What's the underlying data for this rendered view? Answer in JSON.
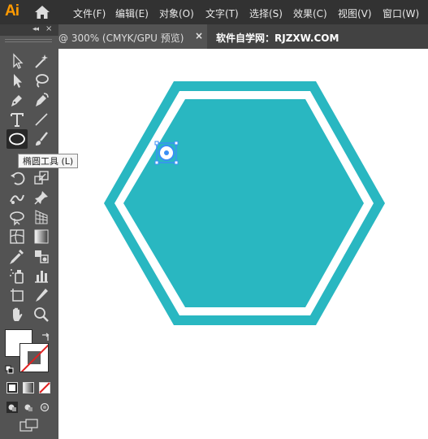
{
  "app": {
    "logo": "Ai"
  },
  "menu": {
    "items": [
      "文件(F)",
      "编辑(E)",
      "对象(O)",
      "文字(T)",
      "选择(S)",
      "效果(C)",
      "视图(V)",
      "窗口(W)"
    ]
  },
  "tabs": {
    "document": "@ 300% (CMYK/GPU 预览)",
    "close": "×",
    "site": "软件自学网：RJZXW.COM"
  },
  "toolpanel": {
    "collapse": "◂◂",
    "close": "×"
  },
  "tooltip": {
    "text": "椭圆工具 (L)"
  },
  "colors": {
    "accent_teal": "#29b7c1",
    "toolbar_bg": "#535353",
    "menubar_bg": "#323232"
  },
  "icons": [
    "selection-icon",
    "magic-wand-icon",
    "direct-selection-icon",
    "lasso-icon",
    "pen-icon",
    "curvature-icon",
    "type-icon",
    "line-segment-icon",
    "ellipse-icon",
    "paintbrush-icon",
    "rotate-icon",
    "scale-icon",
    "puppet-warp-icon",
    "pin-icon",
    "free-transform-icon",
    "perspective-grid-icon",
    "mesh-icon",
    "gradient-icon",
    "eyedropper-icon",
    "blend-icon",
    "symbol-sprayer-icon",
    "column-graph-icon",
    "artboard-icon",
    "slice-icon",
    "hand-icon",
    "zoom-icon"
  ]
}
